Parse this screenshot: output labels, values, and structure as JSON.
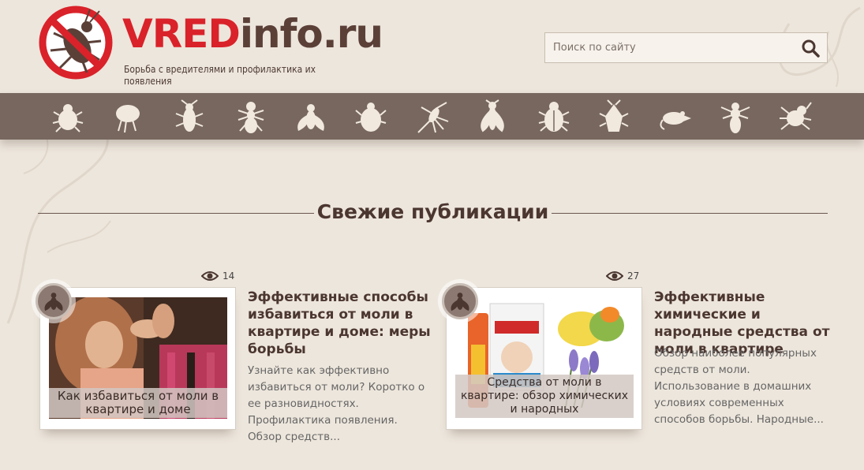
{
  "site": {
    "brand_part1": "VRED",
    "brand_part2": "info.ru",
    "tagline": "Борьба с вредителями и профилактика их появления",
    "accent_color": "#d9222a",
    "brand_color": "#5b4038"
  },
  "search": {
    "placeholder": "Поиск по сайту",
    "icon": "search-icon"
  },
  "pest_nav": {
    "items": [
      {
        "icon": "bug-icon"
      },
      {
        "icon": "flea-icon"
      },
      {
        "icon": "cockroach-icon"
      },
      {
        "icon": "ant-icon"
      },
      {
        "icon": "fly-icon"
      },
      {
        "icon": "tick-icon"
      },
      {
        "icon": "mosquito-icon"
      },
      {
        "icon": "moth-icon"
      },
      {
        "icon": "beetle-icon"
      },
      {
        "icon": "bedbug-icon"
      },
      {
        "icon": "rat-icon"
      },
      {
        "icon": "wasp-icon"
      },
      {
        "icon": "spider-mite-icon"
      }
    ]
  },
  "section": {
    "title": "Свежие публикации"
  },
  "posts": [
    {
      "views": "14",
      "thumb_caption": "Как избавиться от моли в квартире и доме",
      "title": "Эффективные способы избавиться от моли в квартире и доме: меры борьбы",
      "excerpt": "Узнайте как эффективно избавиться от моли? Коротко о ее разновидностях. Профилактика появления. Обзор средств...",
      "badge_icon": "fly-icon"
    },
    {
      "views": "27",
      "thumb_caption": "Средства от моли в квартире: обзор химических и народных",
      "title": "Эффективные химические и народные средства от моли в квартире",
      "excerpt": "Обзор наиболее популярных средств от моли. Использование в домашних условиях современных способов борьбы. Народные...",
      "badge_icon": "fly-icon"
    }
  ]
}
